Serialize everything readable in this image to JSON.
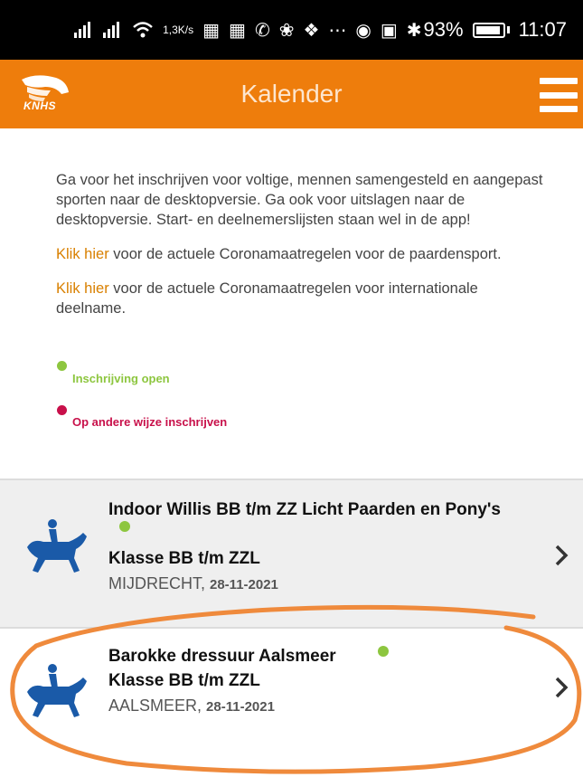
{
  "statusbar": {
    "speed_top": "1,3",
    "speed_bottom": "K/s",
    "battery": "93%",
    "time": "11:07"
  },
  "header": {
    "logo_text": "KNHS",
    "title": "Kalender"
  },
  "info": {
    "paragraph1": "Ga voor het inschrijven voor voltige, mennen samengesteld en aangepast sporten naar de desktopversie. Ga ook voor uitslagen naar de desktopversie. Start- en deelnemerslijsten staan wel in de app!",
    "link1": "Klik hier",
    "text1": " voor de actuele Coronamaatregelen voor de paardensport.",
    "link2": "Klik hier",
    "text2": " voor de actuele Coronamaatregelen voor internationale deelname."
  },
  "legend": {
    "open_label": "Inschrijving open",
    "open_color": "#8dc63f",
    "other_label": "Op andere wijze inschrijven",
    "other_color": "#c8104a"
  },
  "events": [
    {
      "title": "Indoor Willis BB t/m ZZ Licht Paarden en Pony's",
      "class": "Klasse BB t/m ZZL",
      "place": "MIJDRECHT, ",
      "date": "28-11-2021"
    },
    {
      "title": "Barokke dressuur Aalsmeer",
      "class": "Klasse BB t/m ZZL",
      "place": "AALSMEER, ",
      "date": "28-11-2021"
    }
  ],
  "icons": {
    "rider": "horse-rider-icon",
    "chevron": "chevron-right-icon",
    "menu": "hamburger-menu-icon"
  },
  "colors": {
    "brand": "#ee7d0c",
    "rider_blue": "#1a5aa8",
    "annotation": "#ef8a3c"
  }
}
